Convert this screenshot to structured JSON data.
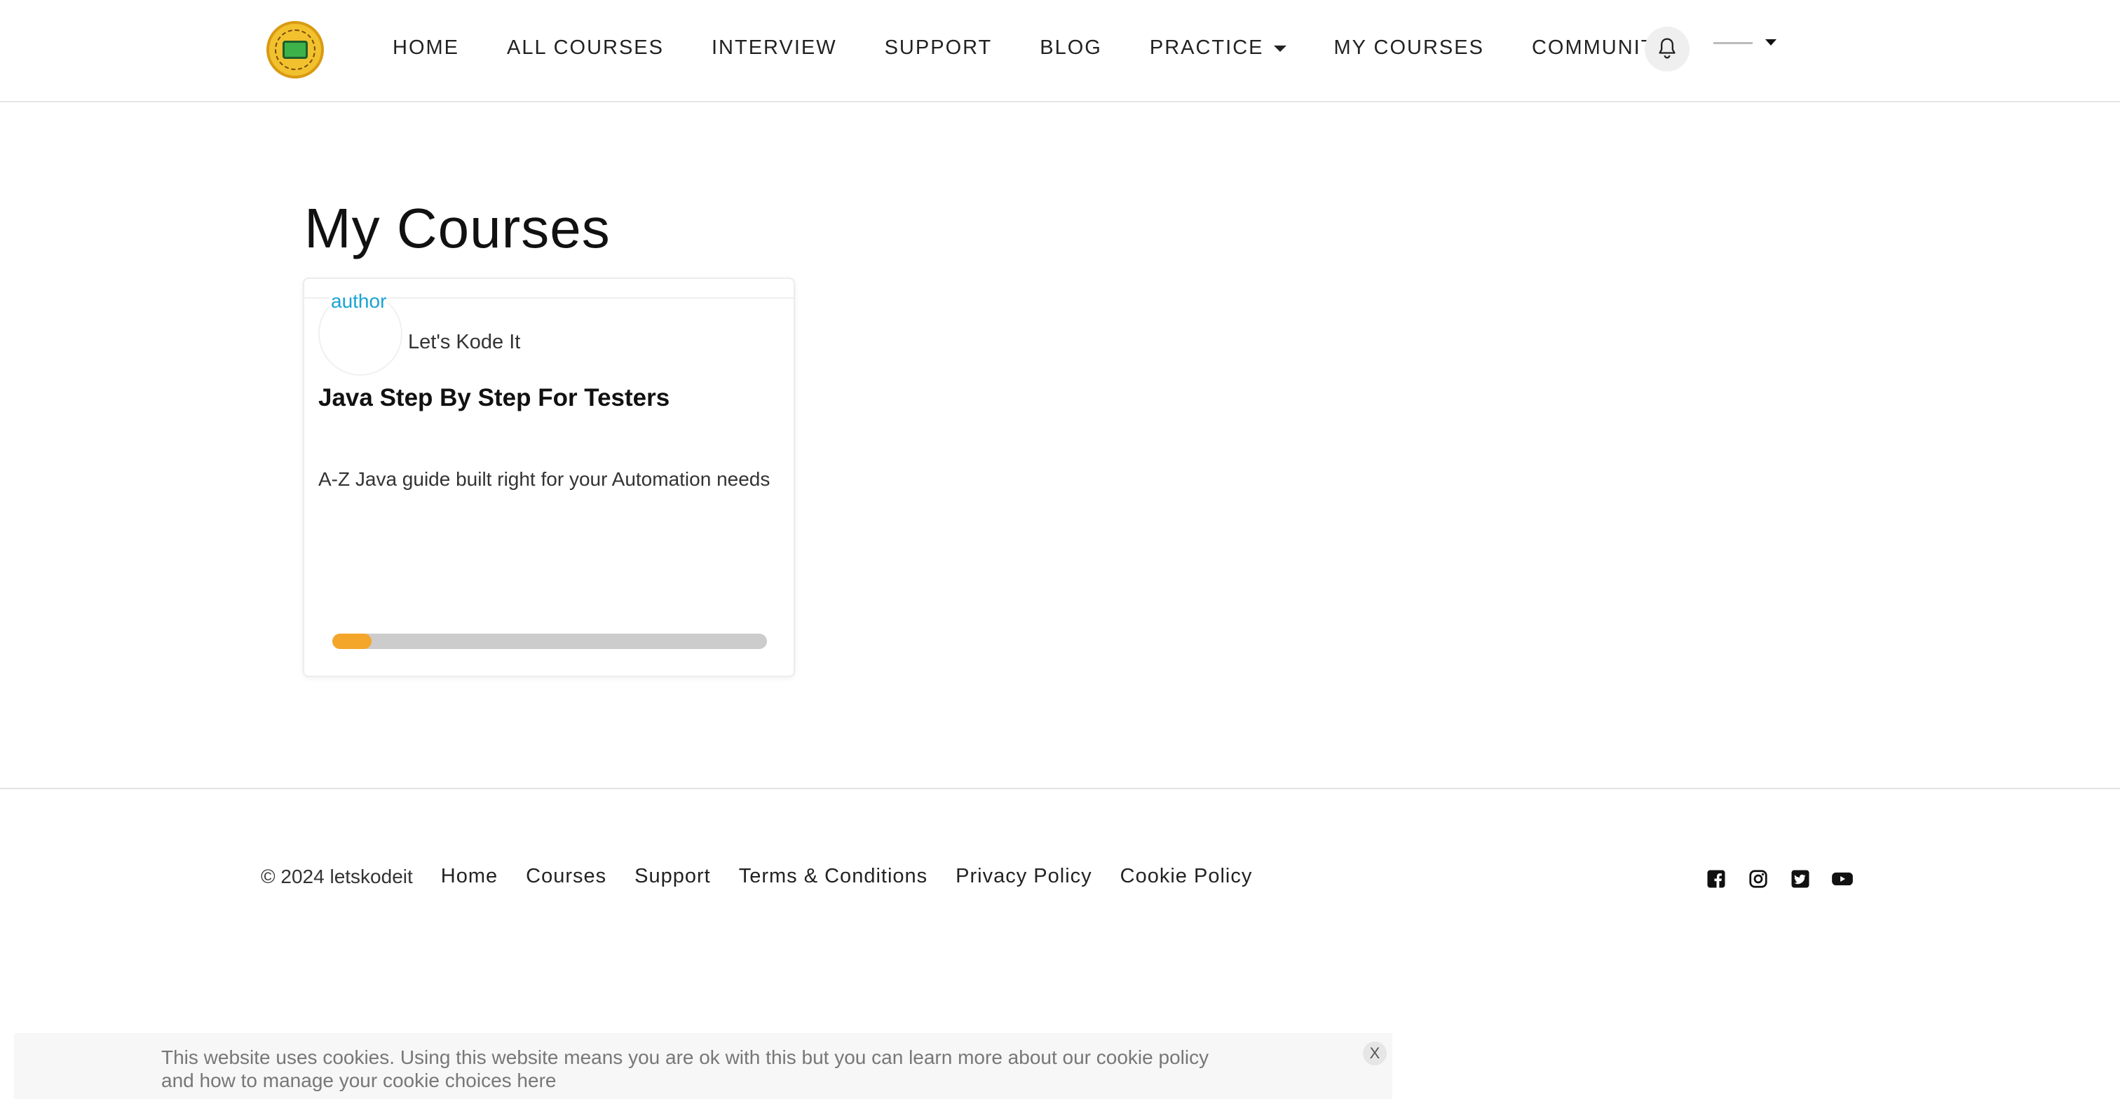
{
  "header": {
    "nav": [
      {
        "label": "HOME"
      },
      {
        "label": "ALL COURSES"
      },
      {
        "label": "INTERVIEW"
      },
      {
        "label": "SUPPORT"
      },
      {
        "label": "BLOG"
      },
      {
        "label": "PRACTICE"
      },
      {
        "label": "MY COURSES"
      },
      {
        "label": "COMMUNITY"
      }
    ],
    "icons": {
      "logo": "logo-badge",
      "bell": "bell-icon",
      "user_menu": "chevron-down-icon"
    }
  },
  "main": {
    "title": "My Courses",
    "courses": [
      {
        "author_tag": "author",
        "author_name": "Let's Kode It",
        "title": "Java Step By Step For Testers",
        "description": "A-Z Java guide built right for your Automation needs",
        "progress": 0.09
      }
    ]
  },
  "footer": {
    "copyright": "© 2024 letskodeit",
    "links": [
      "Home",
      "Courses",
      "Support",
      "Terms & Conditions",
      "Privacy Policy",
      "Cookie Policy"
    ],
    "social": [
      "facebook-icon",
      "instagram-icon",
      "twitter-icon",
      "youtube-icon"
    ]
  },
  "cookie_banner": {
    "text_line1": "This website uses cookies. Using this website means you are ok with this but you can learn more about our cookie policy",
    "text_line2": "and how to manage your cookie choices here",
    "close_label": "X"
  },
  "colors": {
    "accent_blue": "#1aa3d4",
    "progress_fill": "#f3a629",
    "progress_track": "#cccccc"
  }
}
